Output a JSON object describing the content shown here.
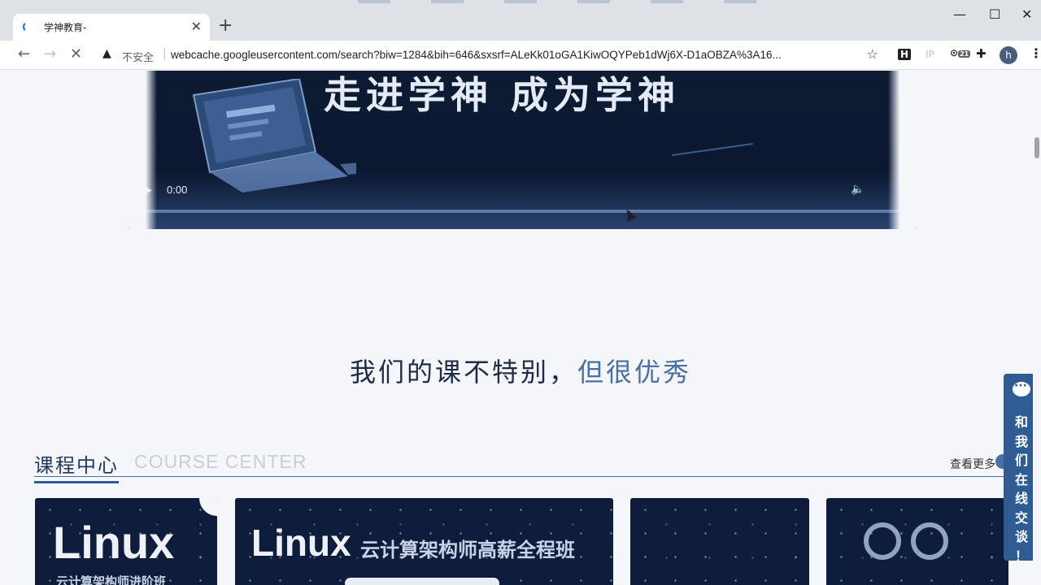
{
  "browser": {
    "tab_title": "学神教育-",
    "new_tab": "+",
    "tab_close": "✕",
    "win_minimize": "—",
    "win_maximize": "☐",
    "win_close": "✕",
    "security_label": "不安全",
    "url": "webcache.googleusercontent.com/search?biw=1284&bih=646&sxsrf=ALeKk01oGA1KiwOQYPeb1dWj6X-D1aOBZA%3A16...",
    "ext_h": "H",
    "ext_ip": "IP",
    "ext_badge": "21",
    "profile_initial": "h"
  },
  "video": {
    "headline": "走进学神  成为学神",
    "time": "0:00"
  },
  "slogan": {
    "part1": "我们的课不特别，",
    "part2": "但很优秀"
  },
  "courses": {
    "title_cn": "课程中心",
    "title_en": "COURSE CENTER",
    "more": "查看更多",
    "cards": [
      {
        "big": "Linux",
        "sub": "云计算架构师进阶班"
      },
      {
        "big": "Linux",
        "sub": "云计算架构师高薪全程班"
      },
      {
        "big": "",
        "sub": ""
      },
      {
        "big": "",
        "sub": ""
      }
    ]
  },
  "chat": {
    "label": "和我们在线交谈！"
  },
  "colors": {
    "accent": "#4a6fa5",
    "heading": "#1e3a64",
    "chat_bg": "#2f5d93"
  }
}
